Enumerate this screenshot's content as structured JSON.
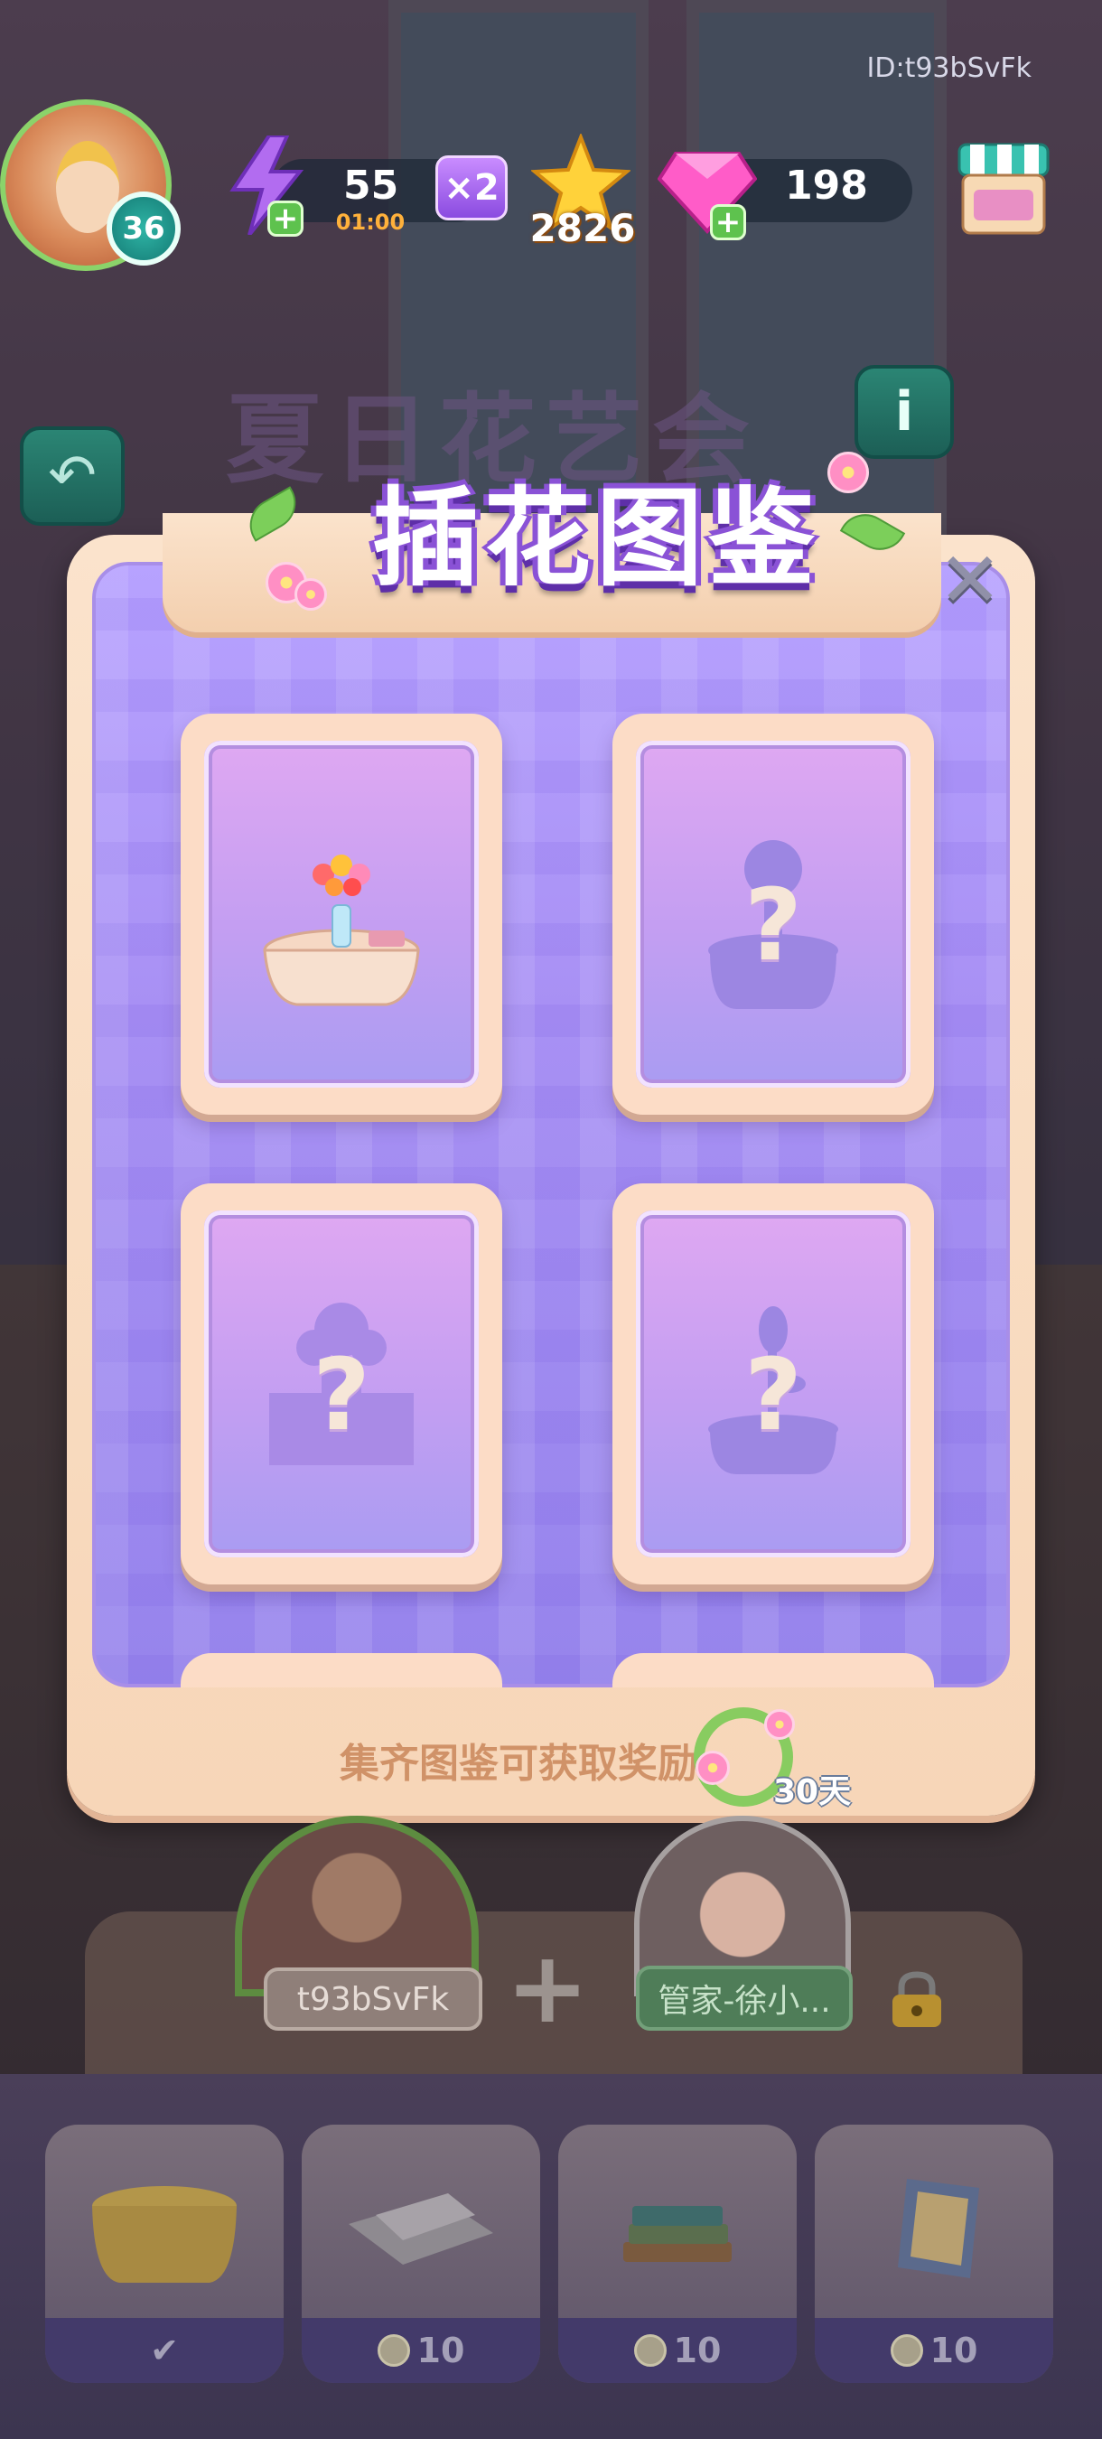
{
  "header": {
    "player_id": "ID:t93bSvFk",
    "level": "36",
    "energy": "55",
    "energy_timer": "01:00",
    "multiplier": "×2",
    "stars": "2826",
    "gems": "198"
  },
  "event": {
    "title": "夏日花艺会"
  },
  "modal": {
    "title": "插花图鉴",
    "close_label": "✕",
    "cards": [
      {
        "state": "unlocked",
        "mark": ""
      },
      {
        "state": "locked",
        "mark": "?"
      },
      {
        "state": "locked",
        "mark": "?"
      },
      {
        "state": "locked",
        "mark": "?"
      }
    ],
    "reward_text": "集齐图鉴可获取奖励",
    "reward_days": "30天"
  },
  "team": {
    "player_name": "t93bSvFk",
    "plus": "+",
    "butler_name": "管家-徐小..."
  },
  "items": [
    {
      "icon": "tablecloth-icon",
      "price": "",
      "owned": true,
      "owned_mark": "✔"
    },
    {
      "icon": "newspaper-icon",
      "price": "10",
      "owned": false
    },
    {
      "icon": "books-icon",
      "price": "10",
      "owned": false
    },
    {
      "icon": "picture-frame-icon",
      "price": "10",
      "owned": false
    }
  ],
  "colors": {
    "accent_purple": "#8a52d6",
    "panel_cream": "#fbe3cc",
    "teal_button": "#2b8574",
    "gold_text": "#ffb13b"
  }
}
